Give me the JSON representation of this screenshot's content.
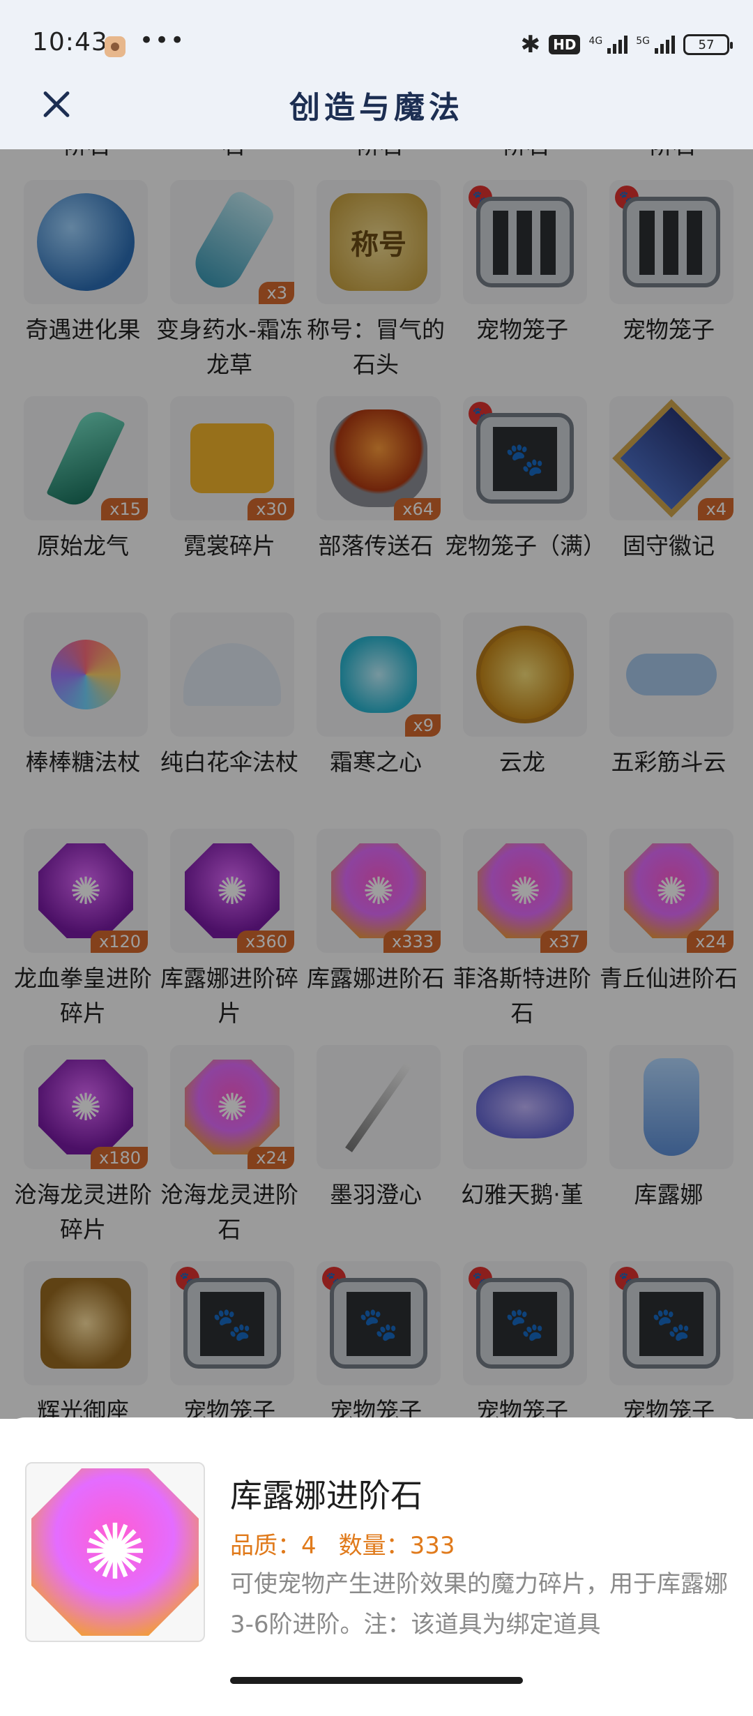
{
  "status_bar": {
    "time": "10:43",
    "more": "•••",
    "battery": "57",
    "network": "5G"
  },
  "header": {
    "title": "创造与魔法"
  },
  "grid": {
    "rows": [
      [
        {
          "name": "奇遇进化果",
          "icon": "fruit-icon",
          "qty": ""
        },
        {
          "name": "变身药水-霜冻龙草",
          "icon": "potion-icon",
          "qty": "x3"
        },
        {
          "name": "称号：冒气的石头",
          "icon": "title-badge-icon",
          "qty": "",
          "badge_text": "称号"
        },
        {
          "name": "宠物笼子",
          "icon": "pet-cage-icon",
          "qty": ""
        },
        {
          "name": "宠物笼子",
          "icon": "pet-cage-icon",
          "qty": ""
        }
      ],
      [
        {
          "name": "原始龙气",
          "icon": "crystal-icon",
          "qty": "x15"
        },
        {
          "name": "霓裳碎片",
          "icon": "shirt-icon",
          "qty": "x30"
        },
        {
          "name": "部落传送石",
          "icon": "stone-icon",
          "qty": "x64"
        },
        {
          "name": "宠物笼子（满）",
          "icon": "pet-cage-full-icon",
          "qty": ""
        },
        {
          "name": "固守徽记",
          "icon": "emblem-icon",
          "qty": "x4"
        }
      ],
      [
        {
          "name": "棒棒糖法杖",
          "icon": "lollipop-icon",
          "qty": ""
        },
        {
          "name": "纯白花伞法杖",
          "icon": "umbrella-icon",
          "qty": ""
        },
        {
          "name": "霜寒之心",
          "icon": "frost-heart-icon",
          "qty": "x9"
        },
        {
          "name": "云龙",
          "icon": "dragon-icon",
          "qty": ""
        },
        {
          "name": "五彩筋斗云",
          "icon": "cloud-icon",
          "qty": ""
        }
      ],
      [
        {
          "name": "龙血拳皇进阶碎片",
          "icon": "gem-icon",
          "qty": "x120"
        },
        {
          "name": "库露娜进阶碎片",
          "icon": "gem-icon",
          "qty": "x360"
        },
        {
          "name": "库露娜进阶石",
          "icon": "gem-bright-icon",
          "qty": "x333"
        },
        {
          "name": "菲洛斯特进阶石",
          "icon": "gem-bright-icon",
          "qty": "x37"
        },
        {
          "name": "青丘仙进阶石",
          "icon": "gem-bright-icon",
          "qty": "x24"
        }
      ],
      [
        {
          "name": "沧海龙灵进阶碎片",
          "icon": "gem-icon",
          "qty": "x180"
        },
        {
          "name": "沧海龙灵进阶石",
          "icon": "gem-bright-icon",
          "qty": "x24"
        },
        {
          "name": "墨羽澄心",
          "icon": "sword-icon",
          "qty": ""
        },
        {
          "name": "幻雅天鹅·堇",
          "icon": "swan-icon",
          "qty": ""
        },
        {
          "name": "库露娜",
          "icon": "fairy-icon",
          "qty": ""
        }
      ],
      [
        {
          "name": "辉光御座",
          "icon": "throne-icon",
          "qty": ""
        },
        {
          "name": "宠物笼子",
          "icon": "pet-cage-full-icon",
          "qty": ""
        },
        {
          "name": "宠物笼子",
          "icon": "pet-cage-full-icon",
          "qty": ""
        },
        {
          "name": "宠物笼子",
          "icon": "pet-cage-full-icon",
          "qty": ""
        },
        {
          "name": "宠物笼子",
          "icon": "pet-cage-full-icon",
          "qty": ""
        }
      ]
    ],
    "top_partial_labels": [
      "阶石",
      "石",
      "阶石",
      "阶石",
      "阶石"
    ]
  },
  "detail": {
    "name": "库露娜进阶石",
    "quality_label": "品质：4",
    "count_label": "数量：333",
    "description": "可使宠物产生进阶效果的魔力碎片，用于库露娜3-6阶进阶。注：该道具为绑定道具"
  }
}
